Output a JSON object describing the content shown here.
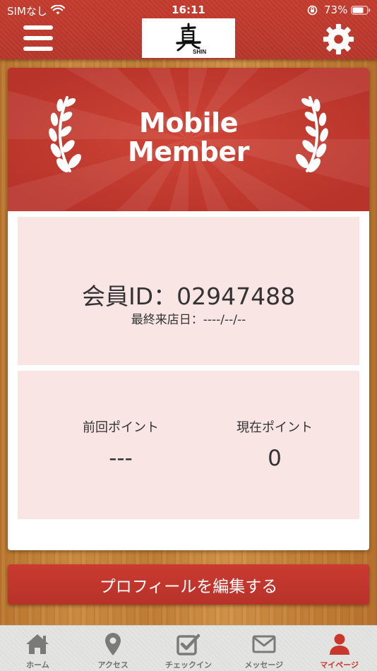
{
  "colors": {
    "header_red": "#c23a2d",
    "panel_pink": "#fae5e5",
    "active_tab": "#c8372b",
    "inactive_tab": "#6f6f6f"
  },
  "status_bar": {
    "carrier": "SIMなし",
    "time": "16:11",
    "battery": "73%"
  },
  "header": {
    "menu_icon": "hamburger-menu-icon",
    "settings_icon": "gear-icon",
    "logo_text": "SHIN"
  },
  "member_card": {
    "banner_title_line1": "Mobile",
    "banner_title_line2": "Member",
    "member_id_label": "会員ID：",
    "member_id": "02947488",
    "last_visit_label": "最終来店日：",
    "last_visit": "----/--/--",
    "previous_points_label": "前回ポイント",
    "previous_points_value": "---",
    "current_points_label": "現在ポイント",
    "current_points_value": "0"
  },
  "edit_profile_button": "プロフィールを編集する",
  "tabs": [
    {
      "label": "ホーム",
      "icon": "home-icon"
    },
    {
      "label": "アクセス",
      "icon": "map-pin-icon"
    },
    {
      "label": "チェックイン",
      "icon": "check-square-icon"
    },
    {
      "label": "メッセージ",
      "icon": "envelope-icon"
    },
    {
      "label": "マイページ",
      "icon": "user-icon",
      "active": true
    }
  ]
}
